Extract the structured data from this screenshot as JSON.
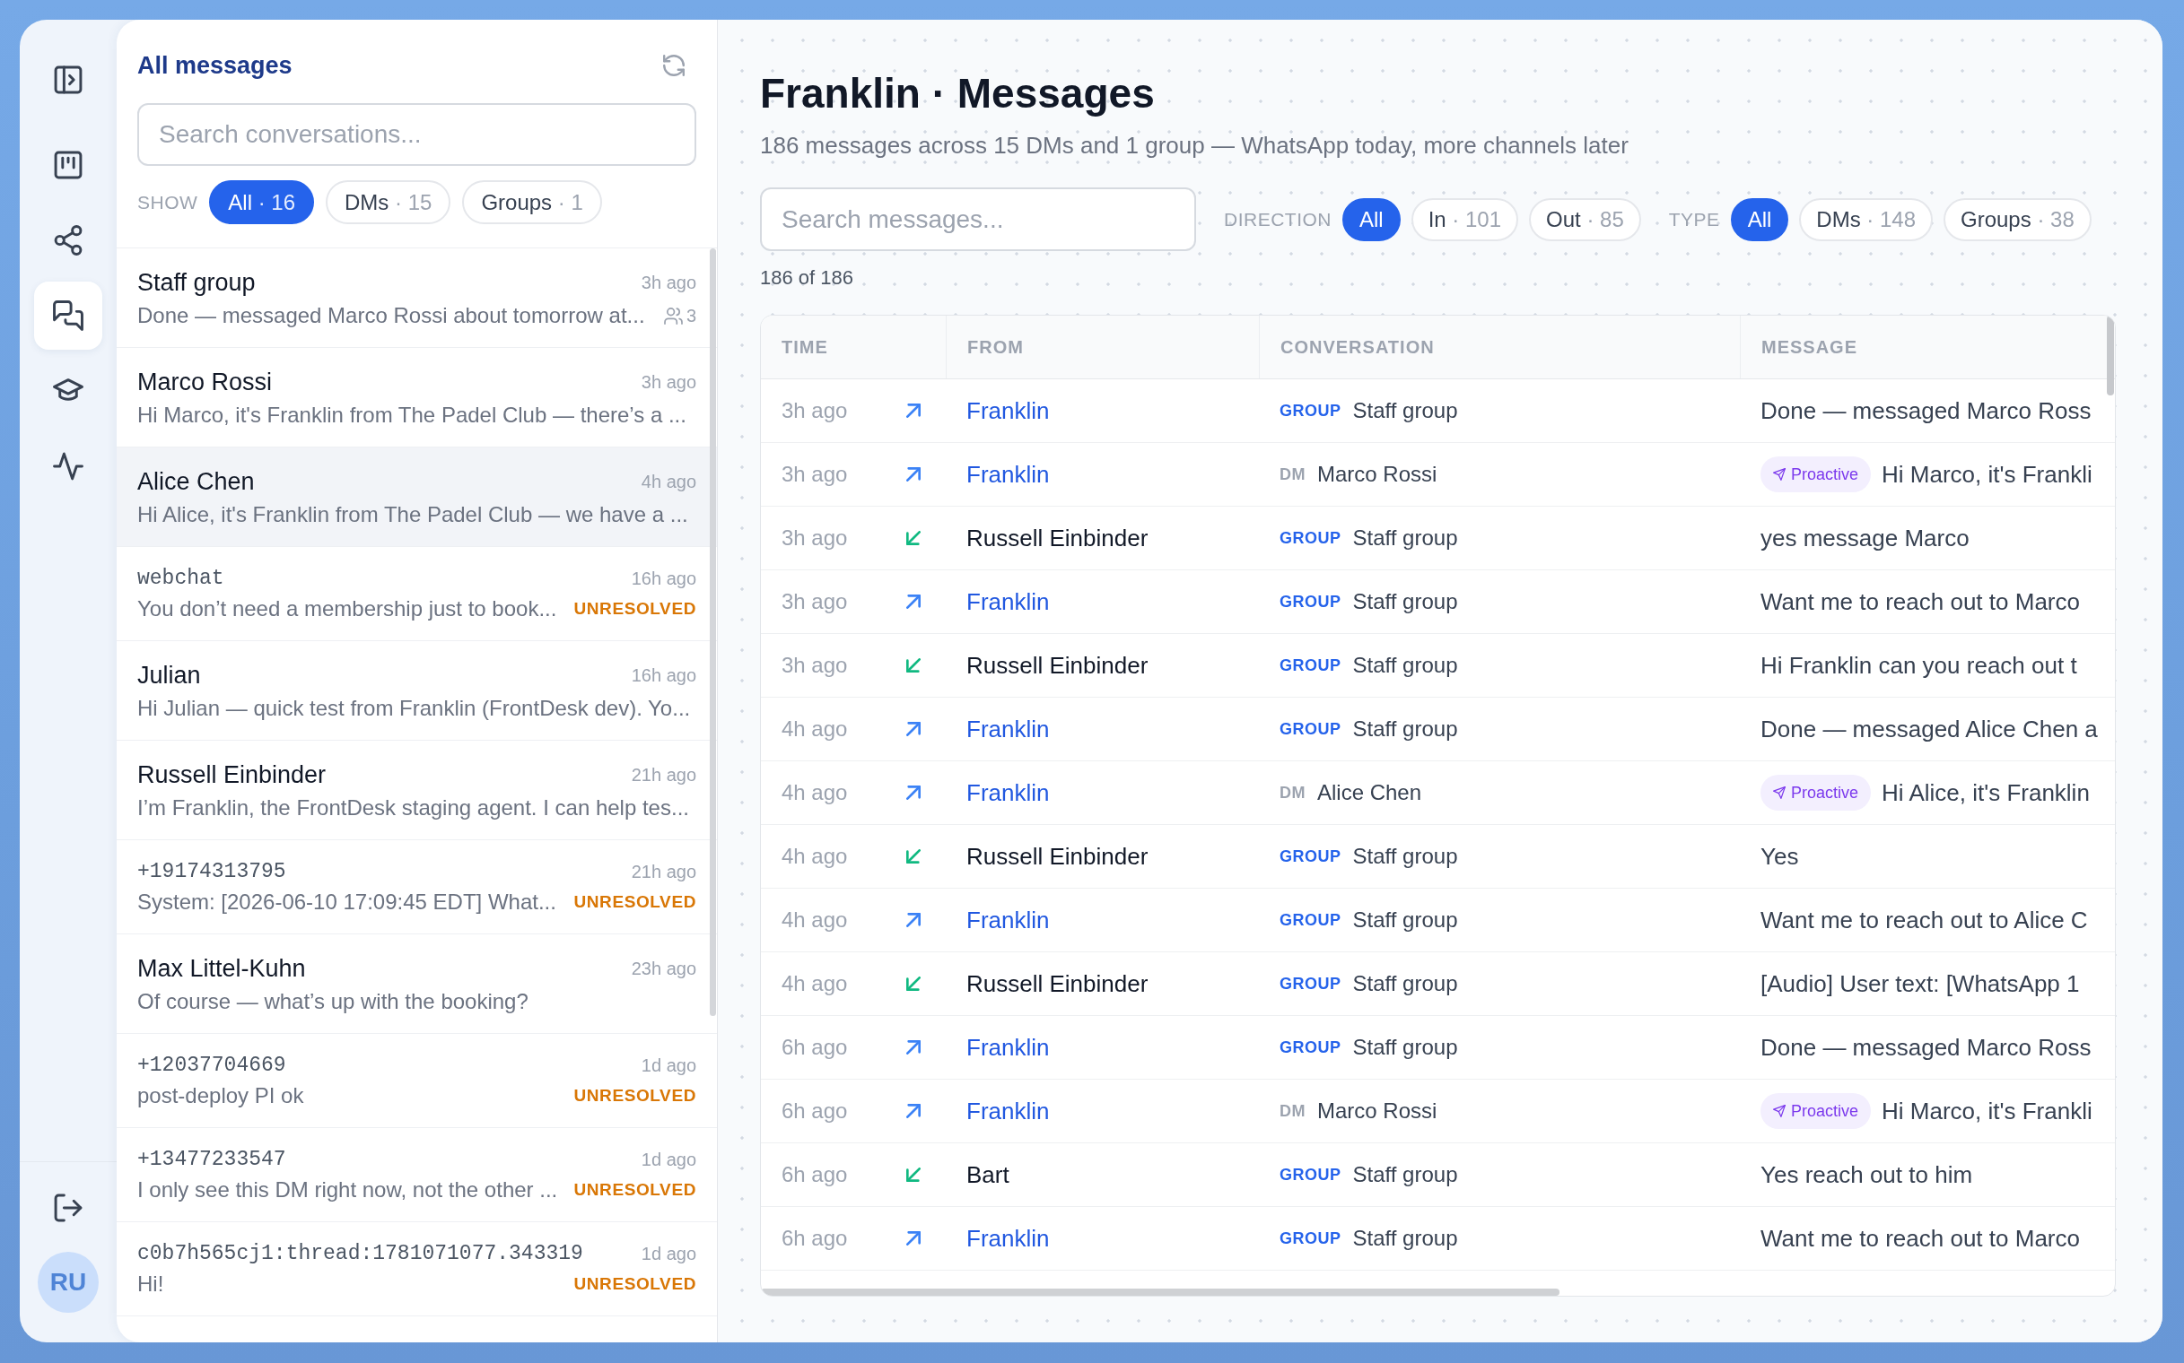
{
  "rail": {
    "items": [
      {
        "selected": false
      },
      {
        "selected": false
      },
      {
        "selected": false
      },
      {
        "selected": true
      },
      {
        "selected": false
      },
      {
        "selected": false
      }
    ],
    "avatar": "RU"
  },
  "sidebar": {
    "title": "All messages",
    "search": {
      "placeholder": "Search conversations..."
    },
    "filter": {
      "label": "SHOW",
      "options": [
        {
          "label": "All",
          "count": "· 16",
          "selected": true
        },
        {
          "label": "DMs",
          "count": "· 15",
          "selected": false
        },
        {
          "label": "Groups",
          "count": "· 1",
          "selected": false
        }
      ]
    },
    "conversations": [
      {
        "kind": "contact",
        "name": "Staff group",
        "time": "3h ago",
        "preview": "Done — messaged Marco Rossi about tomorrow at...",
        "members": "3",
        "selected": false
      },
      {
        "kind": "contact",
        "name": "Marco Rossi",
        "time": "3h ago",
        "preview": "Hi Marco, it's Franklin from The Padel Club — there’s a ...",
        "selected": false
      },
      {
        "kind": "contact",
        "name": "Alice Chen",
        "time": "4h ago",
        "preview": "Hi Alice, it's Franklin from The Padel Club — we have a ...",
        "selected": true
      },
      {
        "kind": "handle",
        "name": "webchat",
        "time": "16h ago",
        "preview": "You don’t need a membership just to book...",
        "status": "UNRESOLVED",
        "selected": false
      },
      {
        "kind": "contact",
        "name": "Julian",
        "time": "16h ago",
        "preview": "Hi Julian — quick test from Franklin (FrontDesk dev). Yo...",
        "selected": false
      },
      {
        "kind": "contact",
        "name": "Russell Einbinder",
        "time": "21h ago",
        "preview": "I’m Franklin, the FrontDesk staging agent. I can help tes...",
        "selected": false
      },
      {
        "kind": "handle",
        "name": "+19174313795",
        "time": "21h ago",
        "preview": "System: [2026-06-10 17:09:45 EDT] What...",
        "status": "UNRESOLVED",
        "selected": false
      },
      {
        "kind": "contact",
        "name": "Max Littel-Kuhn",
        "time": "23h ago",
        "preview": "Of course — what’s up with the booking?",
        "selected": false
      },
      {
        "kind": "handle",
        "name": "+12037704669",
        "time": "1d ago",
        "preview": "post-deploy PI ok",
        "status": "UNRESOLVED",
        "selected": false
      },
      {
        "kind": "handle",
        "name": "+13477233547",
        "time": "1d ago",
        "preview": "I only see this DM right now, not the other ...",
        "status": "UNRESOLVED",
        "selected": false
      },
      {
        "kind": "handle",
        "name": "c0b7h565cj1:thread:1781071077.343319",
        "time": "1d ago",
        "preview": "Hi!",
        "status": "UNRESOLVED",
        "selected": false
      }
    ]
  },
  "main": {
    "title": "Franklin · Messages",
    "subtitle": "186 messages across 15 DMs and 1 group — WhatsApp today, more channels later",
    "search": {
      "placeholder": "Search messages..."
    },
    "filters": [
      {
        "label": "DIRECTION",
        "options": [
          {
            "label": "All",
            "selected": true
          },
          {
            "label": "In",
            "count": "· 101",
            "selected": false
          },
          {
            "label": "Out",
            "count": "· 85",
            "selected": false
          }
        ]
      },
      {
        "label": "TYPE",
        "options": [
          {
            "label": "All",
            "selected": true
          },
          {
            "label": "DMs",
            "count": "· 148",
            "selected": false
          },
          {
            "label": "Groups",
            "count": "· 38",
            "selected": false
          }
        ]
      }
    ],
    "result_count": "186 of 186",
    "table": {
      "columns": [
        "TIME",
        "FROM",
        "CONVERSATION",
        "MESSAGE"
      ],
      "rows": [
        {
          "kind": "outgoing",
          "time": "3h ago",
          "from": "Franklin",
          "conversation": {
            "kind": "group",
            "tag": "GROUP",
            "name": "Staff group"
          },
          "message": "Done — messaged Marco Ross"
        },
        {
          "kind": "outgoing",
          "time": "3h ago",
          "from": "Franklin",
          "conversation": {
            "kind": "dm",
            "tag": "DM",
            "name": "Marco Rossi"
          },
          "tag": "Proactive",
          "message": "Hi Marco, it's Frankli"
        },
        {
          "kind": "incoming",
          "time": "3h ago",
          "from": "Russell Einbinder",
          "conversation": {
            "kind": "group",
            "tag": "GROUP",
            "name": "Staff group"
          },
          "message": "yes message Marco"
        },
        {
          "kind": "outgoing",
          "time": "3h ago",
          "from": "Franklin",
          "conversation": {
            "kind": "group",
            "tag": "GROUP",
            "name": "Staff group"
          },
          "message": "Want me to reach out to Marco"
        },
        {
          "kind": "incoming",
          "time": "3h ago",
          "from": "Russell Einbinder",
          "conversation": {
            "kind": "group",
            "tag": "GROUP",
            "name": "Staff group"
          },
          "message": "Hi Franklin can you reach out t"
        },
        {
          "kind": "outgoing",
          "time": "4h ago",
          "from": "Franklin",
          "conversation": {
            "kind": "group",
            "tag": "GROUP",
            "name": "Staff group"
          },
          "message": "Done — messaged Alice Chen a"
        },
        {
          "kind": "outgoing",
          "time": "4h ago",
          "from": "Franklin",
          "conversation": {
            "kind": "dm",
            "tag": "DM",
            "name": "Alice Chen"
          },
          "tag": "Proactive",
          "message": "Hi Alice, it's Franklin"
        },
        {
          "kind": "incoming",
          "time": "4h ago",
          "from": "Russell Einbinder",
          "conversation": {
            "kind": "group",
            "tag": "GROUP",
            "name": "Staff group"
          },
          "message": "Yes"
        },
        {
          "kind": "outgoing",
          "time": "4h ago",
          "from": "Franklin",
          "conversation": {
            "kind": "group",
            "tag": "GROUP",
            "name": "Staff group"
          },
          "message": "Want me to reach out to Alice C"
        },
        {
          "kind": "incoming",
          "time": "4h ago",
          "from": "Russell Einbinder",
          "conversation": {
            "kind": "group",
            "tag": "GROUP",
            "name": "Staff group"
          },
          "message": "[Audio] User text: [WhatsApp 1"
        },
        {
          "kind": "outgoing",
          "time": "6h ago",
          "from": "Franklin",
          "conversation": {
            "kind": "group",
            "tag": "GROUP",
            "name": "Staff group"
          },
          "message": "Done — messaged Marco Ross"
        },
        {
          "kind": "outgoing",
          "time": "6h ago",
          "from": "Franklin",
          "conversation": {
            "kind": "dm",
            "tag": "DM",
            "name": "Marco Rossi"
          },
          "tag": "Proactive",
          "message": "Hi Marco, it's Frankli"
        },
        {
          "kind": "incoming",
          "time": "6h ago",
          "from": "Bart",
          "conversation": {
            "kind": "group",
            "tag": "GROUP",
            "name": "Staff group"
          },
          "message": "Yes reach out to him"
        },
        {
          "kind": "outgoing",
          "time": "6h ago",
          "from": "Franklin",
          "conversation": {
            "kind": "group",
            "tag": "GROUP",
            "name": "Staff group"
          },
          "message": "Want me to reach out to Marco"
        }
      ]
    }
  }
}
